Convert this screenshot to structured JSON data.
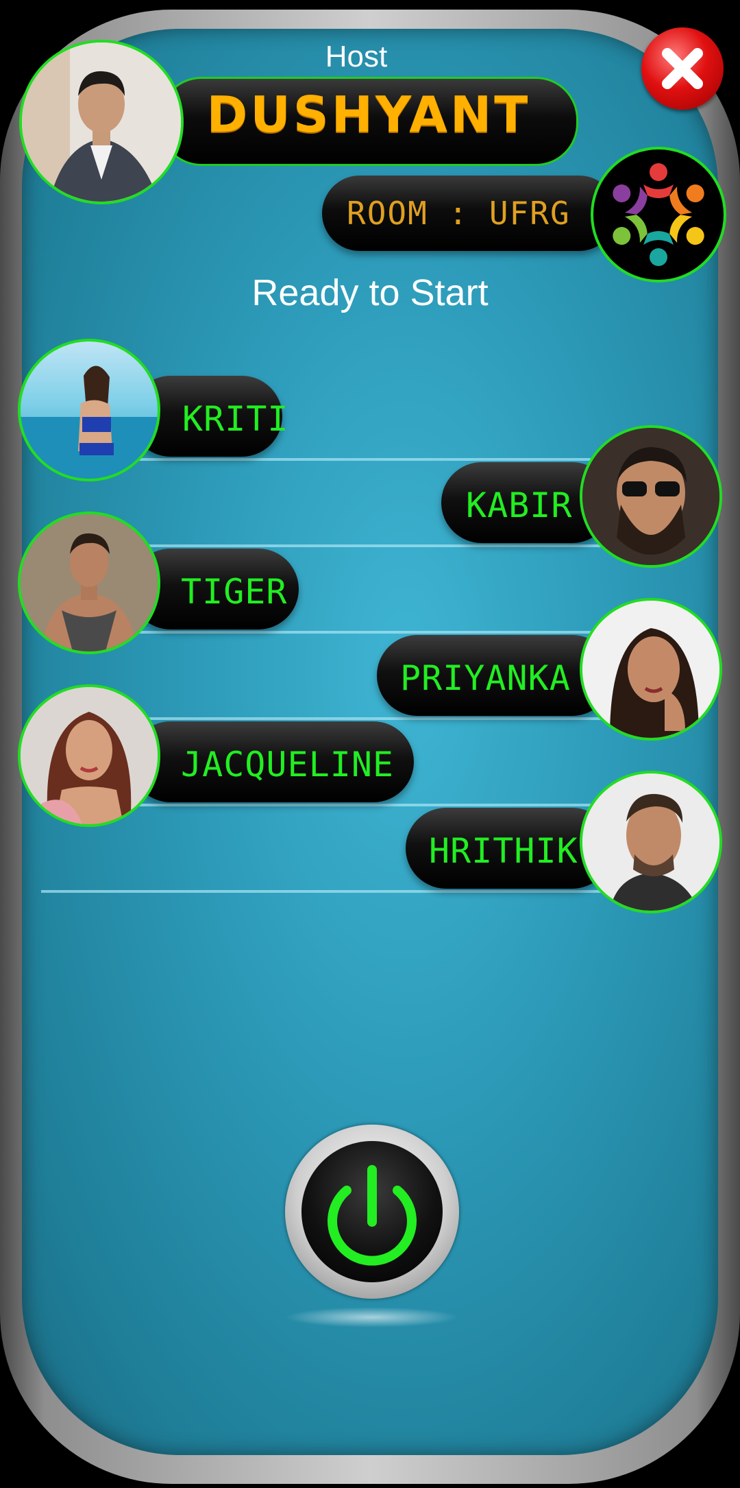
{
  "header": {
    "host_label": "Host",
    "host_name": "DUSHYANT",
    "room_label": "ROOM : UFRG",
    "close_icon": "close-icon"
  },
  "status": "Ready to Start",
  "players": [
    {
      "name": "KRITI",
      "side": "left"
    },
    {
      "name": "KABIR",
      "side": "right"
    },
    {
      "name": "TIGER",
      "side": "left"
    },
    {
      "name": "PRIYANKA",
      "side": "right"
    },
    {
      "name": "JACQUELINE",
      "side": "left"
    },
    {
      "name": "HRITHIK",
      "side": "right"
    }
  ],
  "start_button": {
    "icon": "power-icon"
  },
  "colors": {
    "accent": "#22ee22",
    "host_name": "#ffb000",
    "room_text": "#e0a020",
    "panel": "#2c9ab8",
    "close": "#e01010"
  }
}
